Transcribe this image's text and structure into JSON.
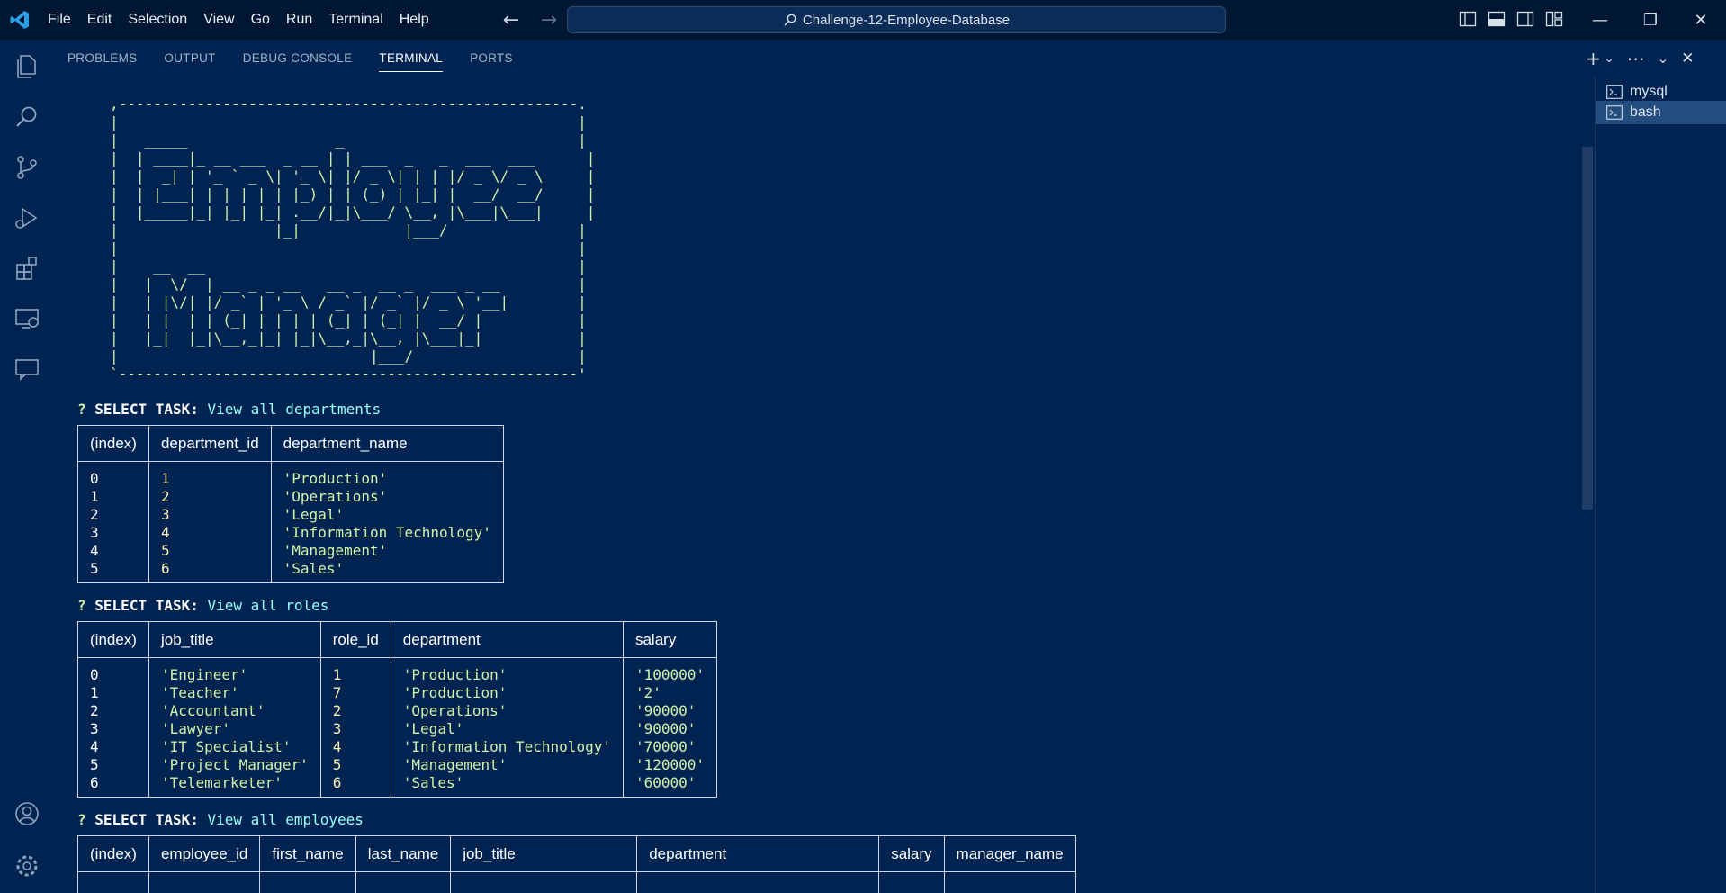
{
  "menu": [
    "File",
    "Edit",
    "Selection",
    "View",
    "Go",
    "Run",
    "Terminal",
    "Help"
  ],
  "search": {
    "label": "Challenge-12-Employee-Database"
  },
  "panel": {
    "tabs": [
      "PROBLEMS",
      "OUTPUT",
      "DEBUG CONSOLE",
      "TERMINAL",
      "PORTS"
    ],
    "active_tab": "TERMINAL"
  },
  "terminal_list": [
    {
      "name": "mysql",
      "active": false
    },
    {
      "name": "bash",
      "active": true
    }
  ],
  "icons": {
    "activity": [
      "explorer-icon",
      "search-icon",
      "source-control-icon",
      "run-debug-icon",
      "extensions-icon",
      "remote-explorer-icon",
      "chat-icon",
      "account-icon",
      "settings-gear-icon"
    ]
  },
  "colors": {
    "bg": "#002451",
    "titlebar": "#001733",
    "accent": "#99ffff",
    "string": "#d1f1a9",
    "number": "#ffeead"
  },
  "banner": ",-----------------------------------------------------.\n|                                                     |\n|   _____                 _                           |\n|  | ____|_ __ ___  _ __ | | ___  _   _  ___  ___      |\n|  |  _| | '_ ` _ \\| '_ \\| |/ _ \\| | | |/ _ \\/ _ \\     |\n|  | |___| | | | | | |_) | | (_) | |_| |  __/  __/     |\n|  |_____|_| |_| |_| .__/|_|\\___/ \\__, |\\___|\\___|     |\n|                  |_|            |___/               |\n|                                                     |\n|    __  __                                           |\n|   |  \\/  | __ _ _ __   __ _  __ _  ___ _ __         |\n|   | |\\/| |/ _` | '_ \\ / _` |/ _` |/ _ \\ '__|        |\n|   | |  | | (_| | | | | (_| | (_| |  __/ |           |\n|   |_|  |_|\\__,_|_| |_|\\__,_|\\__, |\\___|_|           |\n|                             |___/                   |\n`-----------------------------------------------------'",
  "tasks": [
    {
      "prompt_q": "?",
      "prompt_label": "SELECT TASK:",
      "answer": "View all departments",
      "headers": [
        "(index)",
        "department_id",
        "department_name"
      ],
      "types": [
        "idx",
        "num",
        "str"
      ],
      "rows": [
        [
          "0",
          "1",
          "'Production'"
        ],
        [
          "1",
          "2",
          "'Operations'"
        ],
        [
          "2",
          "3",
          "'Legal'"
        ],
        [
          "3",
          "4",
          "'Information Technology'"
        ],
        [
          "4",
          "5",
          "'Management'"
        ],
        [
          "5",
          "6",
          "'Sales'"
        ]
      ]
    },
    {
      "prompt_q": "?",
      "prompt_label": "SELECT TASK:",
      "answer": "View all roles",
      "headers": [
        "(index)",
        "job_title",
        "role_id",
        "department",
        "salary"
      ],
      "types": [
        "idx",
        "str",
        "num",
        "str",
        "str"
      ],
      "rows": [
        [
          "0",
          "'Engineer'",
          "1",
          "'Production'",
          "'100000'"
        ],
        [
          "1",
          "'Teacher'",
          "7",
          "'Production'",
          "'2'"
        ],
        [
          "2",
          "'Accountant'",
          "2",
          "'Operations'",
          "'90000'"
        ],
        [
          "3",
          "'Lawyer'",
          "3",
          "'Legal'",
          "'90000'"
        ],
        [
          "4",
          "'IT Specialist'",
          "4",
          "'Information Technology'",
          "'70000'"
        ],
        [
          "5",
          "'Project Manager'",
          "5",
          "'Management'",
          "'120000'"
        ],
        [
          "6",
          "'Telemarketer'",
          "6",
          "'Sales'",
          "'60000'"
        ]
      ]
    },
    {
      "prompt_q": "?",
      "prompt_label": "SELECT TASK:",
      "answer": "View all employees",
      "headers": [
        "(index)",
        "employee_id",
        "first_name",
        "last_name",
        "job_title",
        "department",
        "salary",
        "manager_name"
      ],
      "types": [
        "idx",
        "num",
        "str",
        "str",
        "str",
        "str",
        "str",
        "str"
      ],
      "widths": [
        0,
        0,
        0,
        0,
        180,
        242,
        0,
        0
      ],
      "rows": []
    }
  ]
}
